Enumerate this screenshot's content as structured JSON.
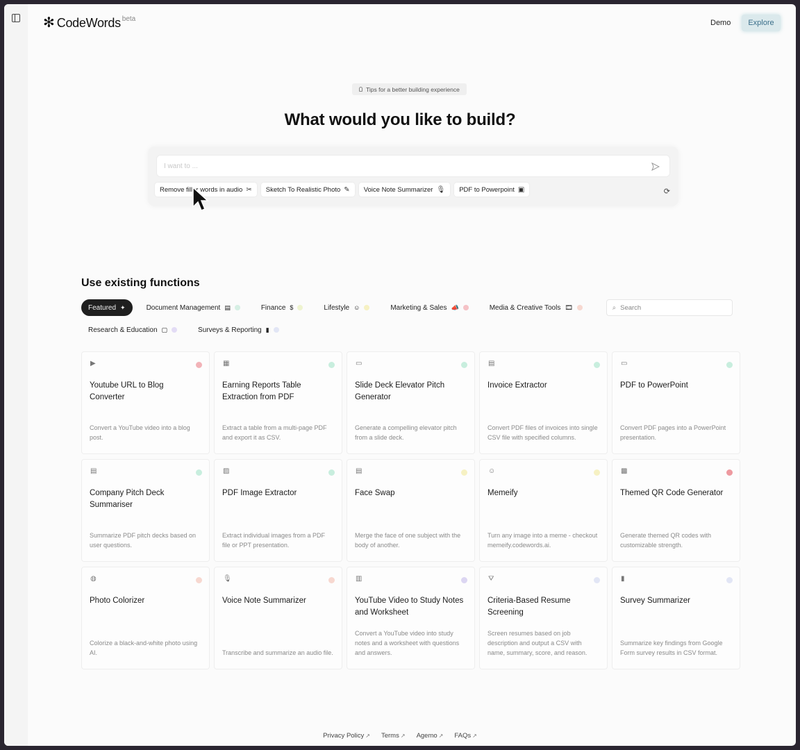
{
  "header": {
    "logo_text": "CodeWords",
    "logo_badge": "beta",
    "demo_label": "Demo",
    "explore_label": "Explore"
  },
  "tips_label": "Tips for a better building experience",
  "hero_title": "What would you like to build?",
  "prompt": {
    "placeholder": "I want to ..."
  },
  "suggestions": [
    {
      "label": "Remove filler words in audio",
      "icon": "scissors-icon",
      "glyph": "✂"
    },
    {
      "label": "Sketch To Realistic Photo",
      "icon": "pencil-icon",
      "glyph": "✎"
    },
    {
      "label": "Voice Note Summarizer",
      "icon": "microphone-icon",
      "glyph": "🎙"
    },
    {
      "label": "PDF to Powerpoint",
      "icon": "presentation-icon",
      "glyph": "▣"
    }
  ],
  "section_title": "Use existing functions",
  "filters": [
    {
      "label": "Featured",
      "glyph": "✦",
      "dot": "",
      "active": true
    },
    {
      "label": "Document Management",
      "glyph": "▤",
      "dot": "#d6efe4"
    },
    {
      "label": "Finance",
      "glyph": "$",
      "dot": "#eef3cf"
    },
    {
      "label": "Lifestyle",
      "glyph": "☺",
      "dot": "#f6f1c3"
    },
    {
      "label": "Marketing & Sales",
      "glyph": "📣",
      "dot": "#f5c2c6"
    },
    {
      "label": "Media & Creative Tools",
      "glyph": "🎞",
      "dot": "#f7d8d0"
    },
    {
      "label": "Research & Education",
      "glyph": "▢",
      "dot": "#e3dcf5"
    },
    {
      "label": "Surveys & Reporting",
      "glyph": "▮",
      "dot": "#e2e6f5"
    }
  ],
  "search_placeholder": "Search",
  "cards": [
    {
      "icon": "play-icon",
      "glyph": "▶",
      "dot": "#f2b3b8",
      "title": "Youtube URL to Blog Converter",
      "desc": "Convert a YouTube video into a blog post."
    },
    {
      "icon": "table-icon",
      "glyph": "▦",
      "dot": "#c8eede",
      "title": "Earning Reports Table Extraction from PDF",
      "desc": "Extract a table from a multi-page PDF and export it as CSV."
    },
    {
      "icon": "monitor-icon",
      "glyph": "▭",
      "dot": "#c8eede",
      "title": "Slide Deck Elevator Pitch Generator",
      "desc": "Generate a compelling elevator pitch from a slide deck."
    },
    {
      "icon": "document-icon",
      "glyph": "▤",
      "dot": "#c8eede",
      "title": "Invoice Extractor",
      "desc": "Convert PDF files of invoices into single CSV file with specified columns."
    },
    {
      "icon": "screen-icon",
      "glyph": "▭",
      "dot": "#c8eede",
      "title": "PDF to PowerPoint",
      "desc": "Convert PDF pages into a PowerPoint presentation."
    },
    {
      "icon": "document-icon",
      "glyph": "▤",
      "dot": "#c8eede",
      "title": "Company Pitch Deck Summariser",
      "desc": "Summarize PDF pitch decks based on user questions."
    },
    {
      "icon": "image-icon",
      "glyph": "▨",
      "dot": "#c8eede",
      "title": "PDF Image Extractor",
      "desc": "Extract individual images from a PDF file or PPT presentation."
    },
    {
      "icon": "document-icon",
      "glyph": "▤",
      "dot": "#f6f1c3",
      "title": "Face Swap",
      "desc": "Merge the face of one subject with the body of another."
    },
    {
      "icon": "smile-icon",
      "glyph": "☺",
      "dot": "#f6f1c3",
      "title": "Memeify",
      "desc": "Turn any image into a meme - checkout memeify.codewords.ai."
    },
    {
      "icon": "qr-icon",
      "glyph": "▩",
      "dot": "#ee9aa0",
      "title": "Themed QR Code Generator",
      "desc": "Generate themed QR codes with customizable strength."
    },
    {
      "icon": "palette-icon",
      "glyph": "◍",
      "dot": "#f7d8d0",
      "title": "Photo Colorizer",
      "desc": "Colorize a black-and-white photo using AI."
    },
    {
      "icon": "microphone-icon",
      "glyph": "🎙",
      "dot": "#f7d8d0",
      "title": "Voice Note Summarizer",
      "desc": "Transcribe and summarize an audio file."
    },
    {
      "icon": "book-icon",
      "glyph": "▥",
      "dot": "#dcd6f2",
      "title": "YouTube Video to Study Notes and Worksheet",
      "desc": "Convert a YouTube video into study notes and a worksheet with questions and answers."
    },
    {
      "icon": "filter-icon",
      "glyph": "⛛",
      "dot": "#e2e6f5",
      "title": "Criteria-Based Resume Screening",
      "desc": "Screen resumes based on job description and output a CSV with name, summary, score, and reason."
    },
    {
      "icon": "bar-chart-icon",
      "glyph": "▮",
      "dot": "#e2e6f5",
      "title": "Survey Summarizer",
      "desc": "Summarize key findings from Google Form survey results in CSV format."
    }
  ],
  "footer": [
    {
      "label": "Privacy Policy"
    },
    {
      "label": "Terms"
    },
    {
      "label": "Agemo"
    },
    {
      "label": "FAQs"
    }
  ],
  "colors": {
    "accent": "#3b6f8a",
    "explore_bg": "#dbe9ec",
    "active_filter_bg": "#1f1f1f"
  }
}
